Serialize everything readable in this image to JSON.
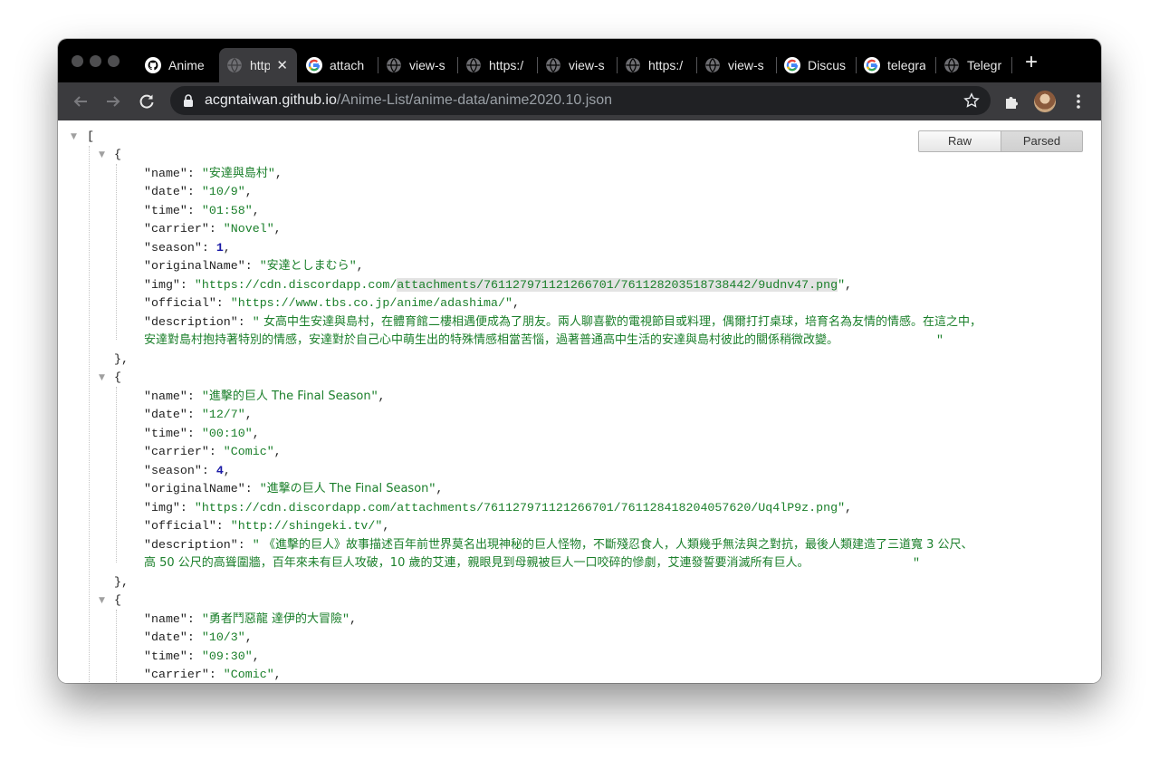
{
  "browser": {
    "tabs": [
      {
        "label": "Anime",
        "favicon": "github-icon"
      },
      {
        "label": "http",
        "favicon": "globe-icon",
        "active": true
      },
      {
        "label": "attach",
        "favicon": "google-icon"
      },
      {
        "label": "view-s",
        "favicon": "globe-icon"
      },
      {
        "label": "https:/",
        "favicon": "globe-icon"
      },
      {
        "label": "view-s",
        "favicon": "globe-icon"
      },
      {
        "label": "https:/",
        "favicon": "globe-icon"
      },
      {
        "label": "view-s",
        "favicon": "globe-icon"
      },
      {
        "label": "Discus",
        "favicon": "google-icon"
      },
      {
        "label": "telegra",
        "favicon": "google-icon"
      },
      {
        "label": "Telegr",
        "favicon": "globe-icon"
      }
    ],
    "new_tab_label": "+",
    "url_host": "acgntaiwan.github.io",
    "url_path": "/Anime-List/anime-data/anime2020.10.json"
  },
  "viewer": {
    "raw_label": "Raw",
    "parsed_label": "Parsed"
  },
  "json_lines": {
    "open_bracket": "[",
    "open_brace": "{",
    "close_brace": "},"
  },
  "entries": [
    {
      "name": "安達與島村",
      "date": "10/9",
      "time": "01:58",
      "carrier": "Novel",
      "season": "1",
      "originalName": "安達としまむら",
      "img_pre": "https://cdn.discordapp.com/",
      "img_hl": "attachments/761127971121266701/761128203518738442/9udnv47.png",
      "official": "https://www.tbs.co.jp/anime/adashima/",
      "description_line1": "女高中生安達與島村，在體育館二樓相遇便成為了朋友。兩人聊喜歡的電視節目或料理，偶爾打打桌球，培育名為友情的情感。在這之中，",
      "description_line2": "安達對島村抱持著特別的情感，安達對於自己心中萌生出的特殊情感相當苦惱，過著普通高中生活的安達與島村彼此的關係稍微改變。"
    },
    {
      "name": "進擊的巨人 The Final Season",
      "date": "12/7",
      "time": "00:10",
      "carrier": "Comic",
      "season": "4",
      "originalName": "進撃の巨人 The Final Season",
      "img": "https://cdn.discordapp.com/attachments/761127971121266701/761128418204057620/Uq4lP9z.png",
      "official": "http://shingeki.tv/",
      "description_line1": "《進擊的巨人》故事描述百年前世界莫名出現神秘的巨人怪物，不斷殘忍食人，人類幾乎無法與之對抗，最後人類建造了三道寬 3 公尺、",
      "description_line2": "高 50 公尺的高聳圍牆，百年來未有巨人攻破，10 歲的艾連，親眼見到母親被巨人一口咬碎的慘劇，艾連發誓要消滅所有巨人。"
    },
    {
      "name": "勇者鬥惡龍 達伊的大冒險",
      "date": "10/3",
      "time": "09:30",
      "carrier": "Comic"
    }
  ],
  "keys": {
    "name": "\"name\"",
    "date": "\"date\"",
    "time": "\"time\"",
    "carrier": "\"carrier\"",
    "season": "\"season\"",
    "originalName": "\"originalName\"",
    "img": "\"img\"",
    "official": "\"official\"",
    "description": "\"description\""
  }
}
